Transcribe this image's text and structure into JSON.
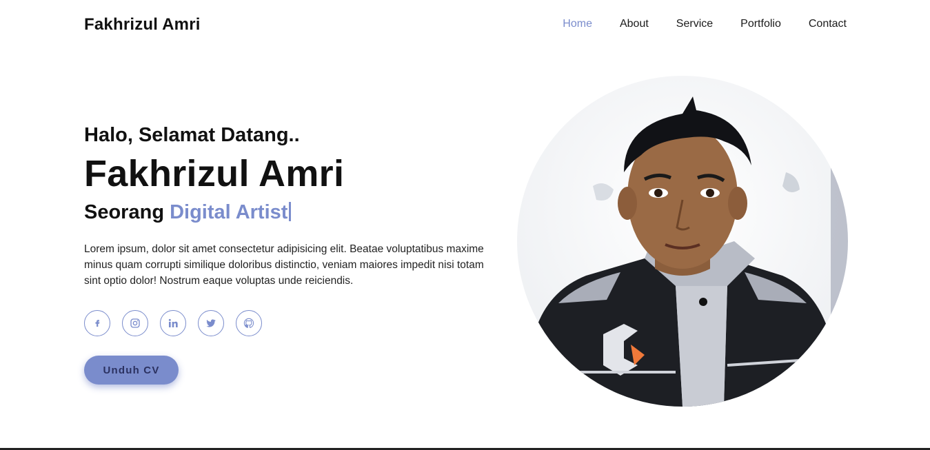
{
  "header": {
    "logo": "Fakhrizul Amri",
    "nav": [
      {
        "label": "Home",
        "active": true
      },
      {
        "label": "About",
        "active": false
      },
      {
        "label": "Service",
        "active": false
      },
      {
        "label": "Portfolio",
        "active": false
      },
      {
        "label": "Contact",
        "active": false
      }
    ]
  },
  "hero": {
    "greeting": "Halo, Selamat Datang..",
    "name": "Fakhrizul Amri",
    "role_prefix": "Seorang",
    "role_highlight": "Digital Artist",
    "description": "Lorem ipsum, dolor sit amet consectetur adipisicing elit. Beatae voluptatibus maxime minus quam corrupti similique doloribus distinctio, veniam maiores impedit nisi totam sint optio dolor! Nostrum eaque voluptas unde reiciendis.",
    "socials": [
      "facebook-icon",
      "instagram-icon",
      "linkedin-icon",
      "twitter-icon",
      "github-icon"
    ],
    "cv_button": "Unduh CV"
  },
  "colors": {
    "accent": "#7a8ccc",
    "text": "#111111",
    "background": "#ffffff"
  }
}
